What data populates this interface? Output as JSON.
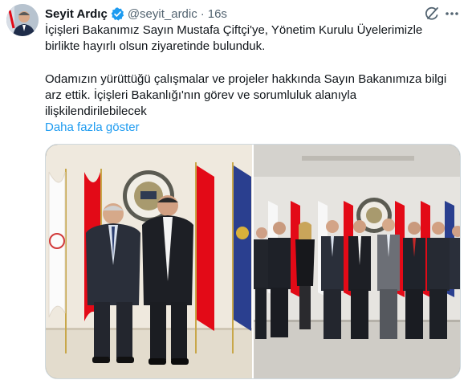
{
  "author": {
    "name": "Seyit Ardıç",
    "handle": "@seyit_ardic",
    "separator": "·",
    "time": "16s"
  },
  "tweet": {
    "paragraph1": "İçişleri Bakanımız Sayın Mustafa Çiftçi'ye, Yönetim Kurulu Üyelerimizle birlikte hayırlı olsun ziyaretinde bulunduk.",
    "paragraph2": "Odamızın yürüttüğü çalışmalar ve projeler hakkında Sayın Bakanımıza bilgi arz ettik. İçişleri Bakanlığı'nın görev ve sorumluluk alanıyla ilişkilendirilebilecek",
    "show_more": "Daha fazla göster"
  },
  "icons": {
    "verified": "verified-badge-icon",
    "grok": "grok-icon",
    "more": "more-options-icon"
  },
  "colors": {
    "accent": "#1d9bf0",
    "text": "#0f1419",
    "muted": "#536471",
    "border": "#cfd9de"
  },
  "media": {
    "photo1": "two men standing in front of flags and an emblem",
    "photo2": "group of nine people standing in front of flags and an emblem"
  }
}
